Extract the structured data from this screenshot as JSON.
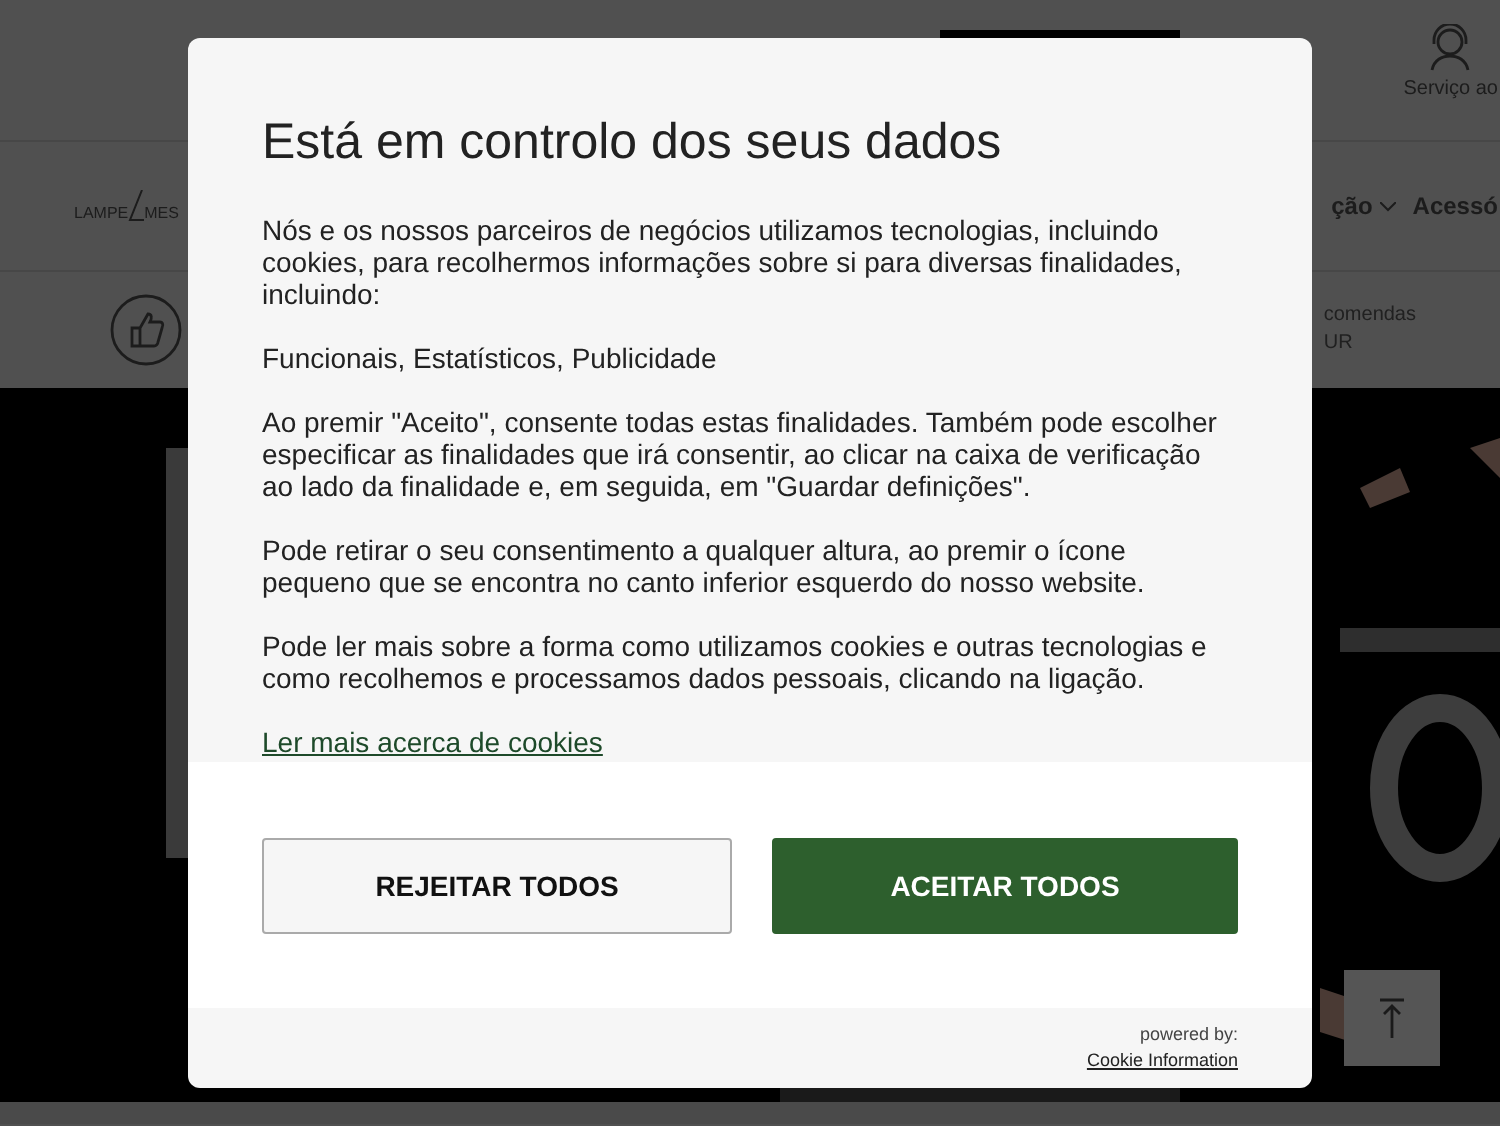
{
  "page": {
    "header": {
      "service_label": "Serviço ao"
    },
    "nav": {
      "logo_left": "LAMPE",
      "logo_right": "MES",
      "items": [
        "ção",
        "Acessó"
      ]
    },
    "info_row": {
      "lines": [
        "comendas",
        "UR"
      ]
    }
  },
  "dialog": {
    "title": "Está em controlo dos seus dados",
    "paragraphs": [
      "Nós e os nossos parceiros de negócios utilizamos tecnologias, incluindo cookies, para recolhermos informações sobre si para diversas finalidades, incluindo:",
      "Funcionais, Estatísticos, Publicidade",
      "Ao premir \"Aceito\", consente todas estas finalidades. Também pode escolher especificar as finalidades que irá consentir, ao clicar na caixa de verificação ao lado da finalidade e, em seguida, em \"Guardar definições\".",
      "Pode retirar o seu consentimento a qualquer altura, ao premir o ícone pequeno que se encontra no canto inferior esquerdo do nosso website.",
      "Pode ler mais sobre a forma como utilizamos cookies e outras tecnologias e como recolhemos e processamos dados pessoais, clicando na ligação."
    ],
    "link": "Ler mais acerca de cookies",
    "buttons": [
      {
        "label": "REJEITAR TODOS",
        "kind": "secondary"
      },
      {
        "label": "ACEITAR TODOS",
        "kind": "primary"
      }
    ],
    "powered_by": "powered by:",
    "provider": "Cookie Information"
  }
}
